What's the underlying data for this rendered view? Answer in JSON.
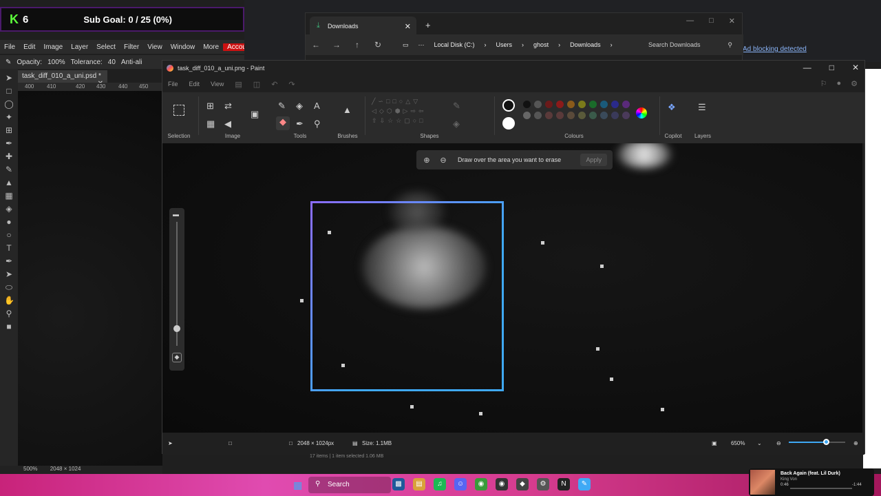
{
  "overlay": {
    "k_logo": "K",
    "count": "6",
    "sub_goal": "Sub Goal: 0 / 25 (0%)"
  },
  "photopea": {
    "menu": [
      "File",
      "Edit",
      "Image",
      "Layer",
      "Select",
      "Filter",
      "View",
      "Window",
      "More",
      "Account"
    ],
    "options": {
      "opacity_label": "Opacity:",
      "opacity_value": "100%",
      "tolerance_label": "Tolerance:",
      "tolerance_value": "40",
      "antialias": "Anti-ali"
    },
    "doc_tab": "task_diff_010_a_uni.psd *",
    "ruler": [
      "400",
      "410",
      "420",
      "430",
      "440",
      "450"
    ],
    "status_zoom": "500%",
    "status_size": "2048 × 1024"
  },
  "browser": {
    "ad_blocking": "Ad blocking detected"
  },
  "explorer": {
    "tab_title": "Downloads",
    "breadcrumb": [
      "Local Disk (C:)",
      "Users",
      "ghost",
      "Downloads"
    ],
    "search_placeholder": "Search Downloads",
    "status": "17 items  |  1 item selected  1.06 MB"
  },
  "paint": {
    "title": "task_diff_010_a_uni.png - Paint",
    "menu": [
      "File",
      "Edit",
      "View"
    ],
    "ribbon_groups": [
      "Selection",
      "Image",
      "Tools",
      "Brushes",
      "Shapes",
      "Colours",
      "Copilot",
      "Layers"
    ],
    "erase_hint": "Draw over the area you want to erase",
    "apply_label": "Apply",
    "status": {
      "dimensions": "2048 × 1024px",
      "size": "Size: 1.1MB",
      "zoom": "650%"
    },
    "colors": {
      "selection_border_start": "#8b6cff",
      "selection_border_end": "#3fa9f5",
      "accent": "#3fa9f5"
    }
  },
  "taskbar": {
    "search_label": "Search",
    "media": {
      "title": "Back Again (feat. Lil Durk)",
      "artist": "King Von",
      "elapsed": "0:46",
      "total": "-1:44"
    }
  }
}
